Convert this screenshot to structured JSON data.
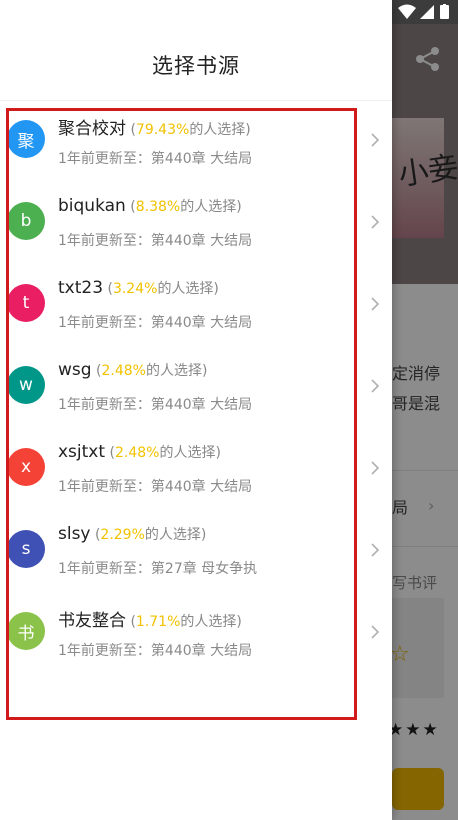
{
  "drawer": {
    "title": "选择书源",
    "suffix_text": "的人选择)",
    "sources": [
      {
        "avatar_char": "聚",
        "avatar_color": "#2196f3",
        "name": "聚合校对",
        "percent": "79.43%",
        "update": "1年前更新至：第440章 大结局"
      },
      {
        "avatar_char": "b",
        "avatar_color": "#4caf50",
        "name": "biqukan",
        "percent": "8.38%",
        "update": "1年前更新至：第440章 大结局"
      },
      {
        "avatar_char": "t",
        "avatar_color": "#e91e63",
        "name": "txt23",
        "percent": "3.24%",
        "update": "1年前更新至：第440章 大结局"
      },
      {
        "avatar_char": "w",
        "avatar_color": "#009688",
        "name": "wsg",
        "percent": "2.48%",
        "update": "1年前更新至：第440章 大结局"
      },
      {
        "avatar_char": "x",
        "avatar_color": "#f44336",
        "name": "xsjtxt",
        "percent": "2.48%",
        "update": "1年前更新至：第440章 大结局"
      },
      {
        "avatar_char": "s",
        "avatar_color": "#3f51b5",
        "name": "slsy",
        "percent": "2.29%",
        "update": "1年前更新至：第27章 母女争执"
      },
      {
        "avatar_char": "书",
        "avatar_color": "#8bc34a",
        "name": "书友整合",
        "percent": "1.71%",
        "update": "1年前更新至：第440章 大结局"
      }
    ]
  },
  "background": {
    "cover_text": "小妾",
    "snippet_line1": "定消停",
    "snippet_line2": "哥是混",
    "latest_chapter": "局",
    "write_review": "写书评",
    "stars": "★★★"
  },
  "colors": {
    "percent": "#f2c200",
    "highlight": "#d11b1b",
    "accent_button": "#f0b800"
  }
}
